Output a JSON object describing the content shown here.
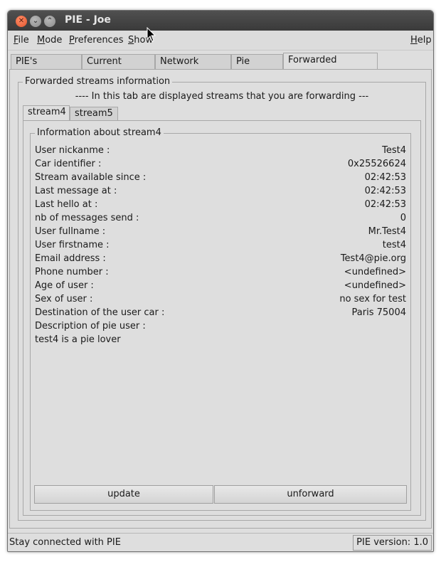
{
  "window": {
    "title": "PIE - Joe"
  },
  "menubar": {
    "file": "File",
    "mode": "Mode",
    "preferences": "Preferences",
    "show": "Show",
    "help": "Help"
  },
  "tabs": [
    {
      "label": "PIE's interface"
    },
    {
      "label": "Current profile"
    },
    {
      "label": "Network traces"
    },
    {
      "label": "Pie traces"
    },
    {
      "label": "Forwarded streams"
    }
  ],
  "forwarded": {
    "group_title": "Forwarded streams information",
    "subtitle": "---- In this tab are displayed streams that you are forwarding ---",
    "stream_tabs": [
      {
        "label": "stream4"
      },
      {
        "label": "stream5"
      }
    ],
    "info_title": "Information about stream4",
    "fields": [
      {
        "label": "User nickanme :",
        "value": "Test4"
      },
      {
        "label": "Car identifier :",
        "value": "0x25526624"
      },
      {
        "label": "Stream available since :",
        "value": "02:42:53"
      },
      {
        "label": "Last message at :",
        "value": "02:42:53"
      },
      {
        "label": "Last hello at :",
        "value": "02:42:53"
      },
      {
        "label": "nb of messages send :",
        "value": "0"
      },
      {
        "label": "User fullname :",
        "value": "Mr.Test4"
      },
      {
        "label": "User firstname :",
        "value": "test4"
      },
      {
        "label": "Email address :",
        "value": "Test4@pie.org"
      },
      {
        "label": "Phone number :",
        "value": "<undefined>"
      },
      {
        "label": "Age of user :",
        "value": "<undefined>"
      },
      {
        "label": "Sex of user :",
        "value": "no sex for test"
      },
      {
        "label": "Destination of the user car :",
        "value": "Paris 75004"
      },
      {
        "label": "Description of pie user :",
        "value": ""
      }
    ],
    "description": "test4 is a pie lover",
    "update_label": "update",
    "unforward_label": "unforward"
  },
  "status": {
    "message": "Stay connected with PIE",
    "version": "PIE version: 1.0"
  }
}
